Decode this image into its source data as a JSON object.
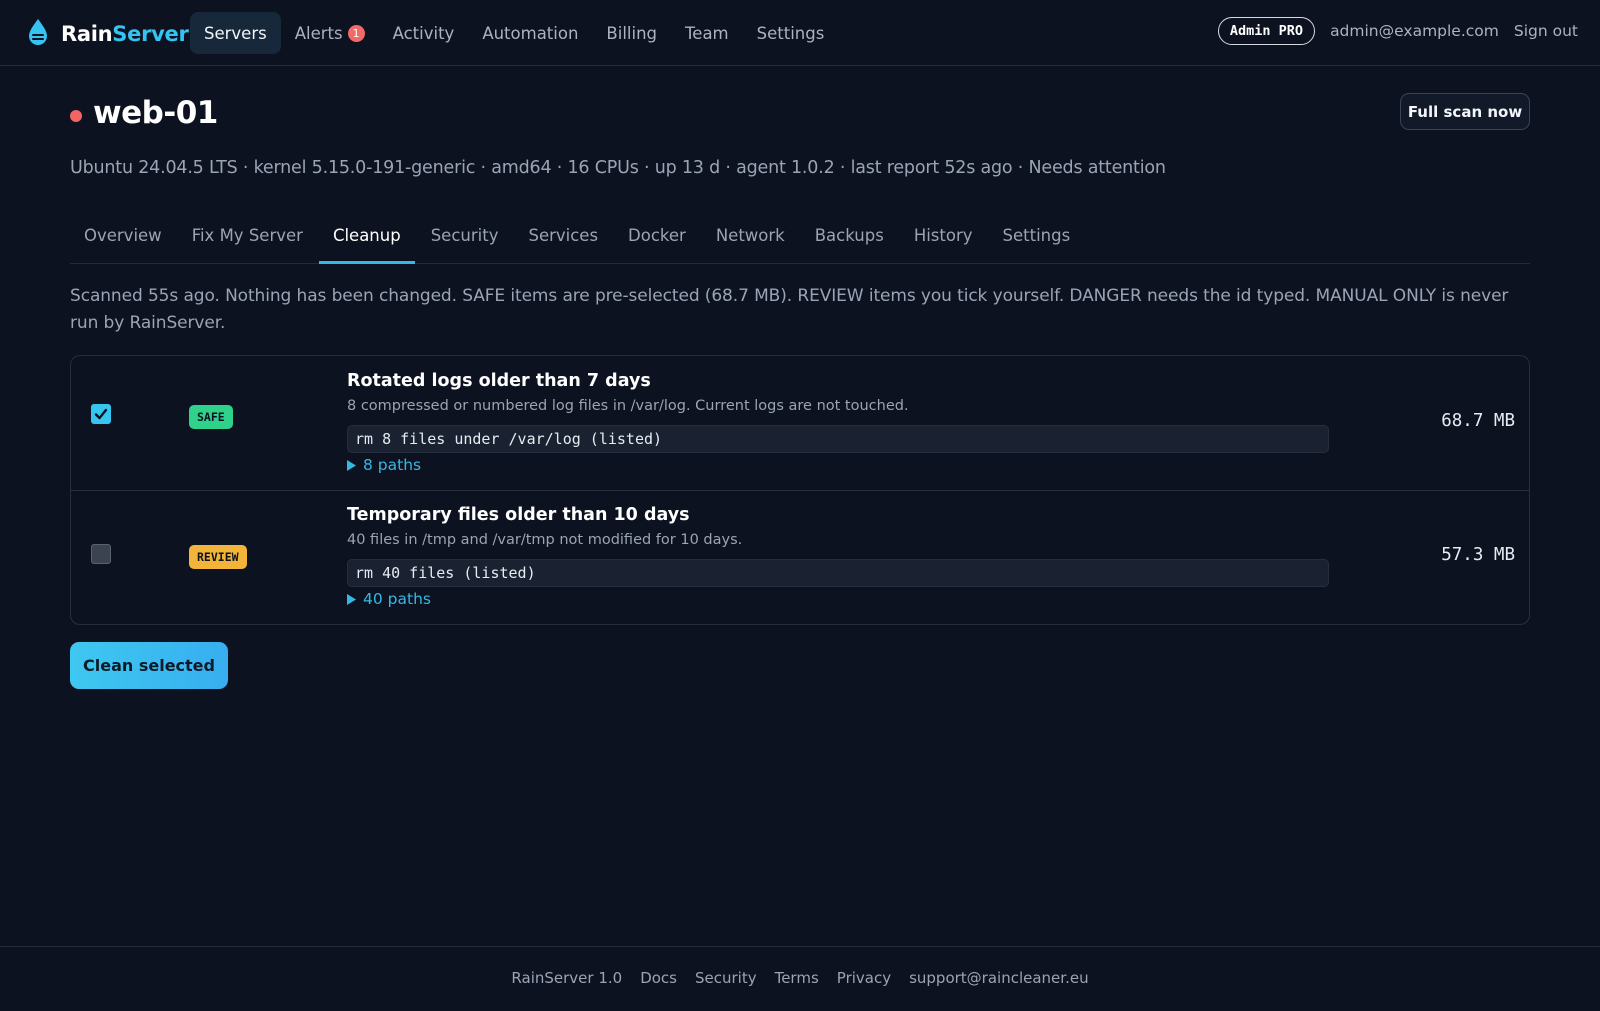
{
  "brand": {
    "name_part1": "Rain",
    "name_part2": "Server",
    "logo_icon": "droplet-icon",
    "accent": "#35c3f2"
  },
  "nav": {
    "items": [
      {
        "label": "Servers",
        "active": true
      },
      {
        "label": "Alerts",
        "badge": "1"
      },
      {
        "label": "Activity"
      },
      {
        "label": "Automation"
      },
      {
        "label": "Billing"
      },
      {
        "label": "Team"
      },
      {
        "label": "Settings"
      }
    ],
    "plan_badge": "Admin PRO",
    "email": "admin@example.com",
    "signout": "Sign out"
  },
  "server": {
    "name": "web-01",
    "status_color": "#f26565",
    "meta": "Ubuntu 24.04.5 LTS · kernel 5.15.0-191-generic · amd64 · 16 CPUs · up 13 d · agent 1.0.2 · last report 52s ago · Needs attention",
    "scan_button": "Full scan now"
  },
  "tabs": [
    {
      "label": "Overview"
    },
    {
      "label": "Fix My Server"
    },
    {
      "label": "Cleanup",
      "active": true
    },
    {
      "label": "Security"
    },
    {
      "label": "Services"
    },
    {
      "label": "Docker"
    },
    {
      "label": "Network"
    },
    {
      "label": "Backups"
    },
    {
      "label": "History"
    },
    {
      "label": "Settings"
    }
  ],
  "cleanup": {
    "intro": "Scanned 55s ago. Nothing has been changed. SAFE items are pre-selected (68.7 MB). REVIEW items you tick yourself. DANGER needs the id typed. MANUAL ONLY is never run by RainServer.",
    "items": [
      {
        "checked": true,
        "badge": "SAFE",
        "badge_color": "#2fd28a",
        "title": "Rotated logs older than 7 days",
        "description": "8 compressed or numbered log files in /var/log. Current logs are not touched.",
        "command": "rm 8 files under /var/log (listed)",
        "paths_label": "8 paths",
        "size": "68.7 MB"
      },
      {
        "checked": false,
        "badge": "REVIEW",
        "badge_color": "#f2b53a",
        "title": "Temporary files older than 10 days",
        "description": "40 files in /tmp and /var/tmp not modified for 10 days.",
        "command": "rm 40 files (listed)",
        "paths_label": "40 paths",
        "size": "57.3 MB"
      }
    ],
    "clean_button": "Clean selected"
  },
  "footer": {
    "links": [
      "RainServer 1.0",
      "Docs",
      "Security",
      "Terms",
      "Privacy",
      "support@raincleaner.eu"
    ]
  }
}
